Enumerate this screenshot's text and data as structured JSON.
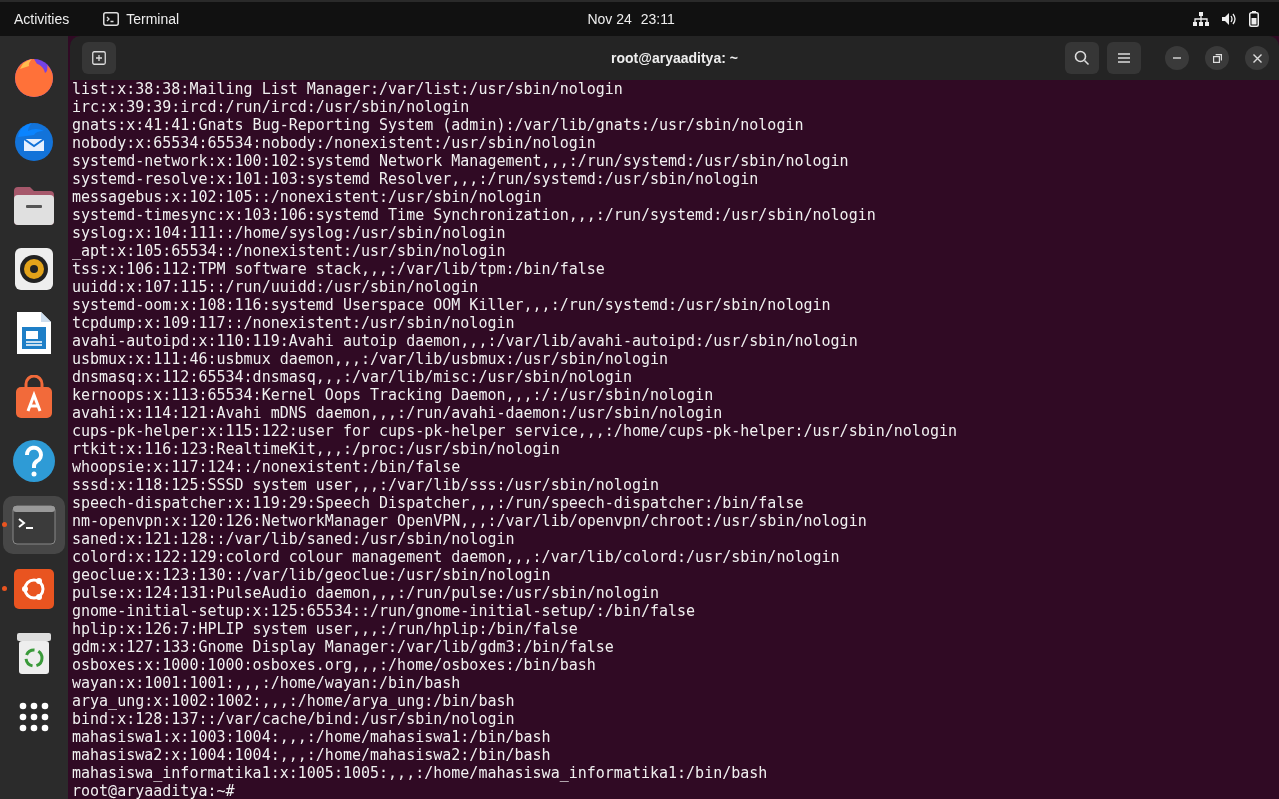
{
  "top_bar": {
    "activities": "Activities",
    "app_name": "Terminal",
    "date": "Nov 24",
    "time": "23:11"
  },
  "dock": [
    {
      "kind": "firefox",
      "running": false,
      "selected": false
    },
    {
      "kind": "thunderbird",
      "running": false,
      "selected": false
    },
    {
      "kind": "files",
      "running": false,
      "selected": false
    },
    {
      "kind": "rhythmbox",
      "running": false,
      "selected": false
    },
    {
      "kind": "writer",
      "running": false,
      "selected": false
    },
    {
      "kind": "app-center",
      "running": false,
      "selected": false
    },
    {
      "kind": "help",
      "running": false,
      "selected": false
    },
    {
      "kind": "terminal",
      "running": true,
      "selected": true
    },
    {
      "kind": "ubuntu",
      "running": true,
      "selected": false
    },
    {
      "kind": "trash",
      "running": false,
      "selected": false
    },
    {
      "kind": "app-grid",
      "running": false,
      "selected": false
    }
  ],
  "window": {
    "title": "root@aryaaditya: ~"
  },
  "terminal_lines": [
    "list:x:38:38:Mailing List Manager:/var/list:/usr/sbin/nologin",
    "irc:x:39:39:ircd:/run/ircd:/usr/sbin/nologin",
    "gnats:x:41:41:Gnats Bug-Reporting System (admin):/var/lib/gnats:/usr/sbin/nologin",
    "nobody:x:65534:65534:nobody:/nonexistent:/usr/sbin/nologin",
    "systemd-network:x:100:102:systemd Network Management,,,:/run/systemd:/usr/sbin/nologin",
    "systemd-resolve:x:101:103:systemd Resolver,,,:/run/systemd:/usr/sbin/nologin",
    "messagebus:x:102:105::/nonexistent:/usr/sbin/nologin",
    "systemd-timesync:x:103:106:systemd Time Synchronization,,,:/run/systemd:/usr/sbin/nologin",
    "syslog:x:104:111::/home/syslog:/usr/sbin/nologin",
    "_apt:x:105:65534::/nonexistent:/usr/sbin/nologin",
    "tss:x:106:112:TPM software stack,,,:/var/lib/tpm:/bin/false",
    "uuidd:x:107:115::/run/uuidd:/usr/sbin/nologin",
    "systemd-oom:x:108:116:systemd Userspace OOM Killer,,,:/run/systemd:/usr/sbin/nologin",
    "tcpdump:x:109:117::/nonexistent:/usr/sbin/nologin",
    "avahi-autoipd:x:110:119:Avahi autoip daemon,,,:/var/lib/avahi-autoipd:/usr/sbin/nologin",
    "usbmux:x:111:46:usbmux daemon,,,:/var/lib/usbmux:/usr/sbin/nologin",
    "dnsmasq:x:112:65534:dnsmasq,,,:/var/lib/misc:/usr/sbin/nologin",
    "kernoops:x:113:65534:Kernel Oops Tracking Daemon,,,:/:/usr/sbin/nologin",
    "avahi:x:114:121:Avahi mDNS daemon,,,:/run/avahi-daemon:/usr/sbin/nologin",
    "cups-pk-helper:x:115:122:user for cups-pk-helper service,,,:/home/cups-pk-helper:/usr/sbin/nologin",
    "rtkit:x:116:123:RealtimeKit,,,:/proc:/usr/sbin/nologin",
    "whoopsie:x:117:124::/nonexistent:/bin/false",
    "sssd:x:118:125:SSSD system user,,,:/var/lib/sss:/usr/sbin/nologin",
    "speech-dispatcher:x:119:29:Speech Dispatcher,,,:/run/speech-dispatcher:/bin/false",
    "nm-openvpn:x:120:126:NetworkManager OpenVPN,,,:/var/lib/openvpn/chroot:/usr/sbin/nologin",
    "saned:x:121:128::/var/lib/saned:/usr/sbin/nologin",
    "colord:x:122:129:colord colour management daemon,,,:/var/lib/colord:/usr/sbin/nologin",
    "geoclue:x:123:130::/var/lib/geoclue:/usr/sbin/nologin",
    "pulse:x:124:131:PulseAudio daemon,,,:/run/pulse:/usr/sbin/nologin",
    "gnome-initial-setup:x:125:65534::/run/gnome-initial-setup/:/bin/false",
    "hplip:x:126:7:HPLIP system user,,,:/run/hplip:/bin/false",
    "gdm:x:127:133:Gnome Display Manager:/var/lib/gdm3:/bin/false",
    "osboxes:x:1000:1000:osboxes.org,,,:/home/osboxes:/bin/bash",
    "wayan:x:1001:1001:,,,:/home/wayan:/bin/bash",
    "arya_ung:x:1002:1002:,,,:/home/arya_ung:/bin/bash",
    "bind:x:128:137::/var/cache/bind:/usr/sbin/nologin",
    "mahasiswa1:x:1003:1004:,,,:/home/mahasiswa1:/bin/bash",
    "mahasiswa2:x:1004:1004:,,,:/home/mahasiswa2:/bin/bash",
    "mahasiswa_informatika1:x:1005:1005:,,,:/home/mahasiswa_informatika1:/bin/bash",
    "root@aryaaditya:~#"
  ]
}
